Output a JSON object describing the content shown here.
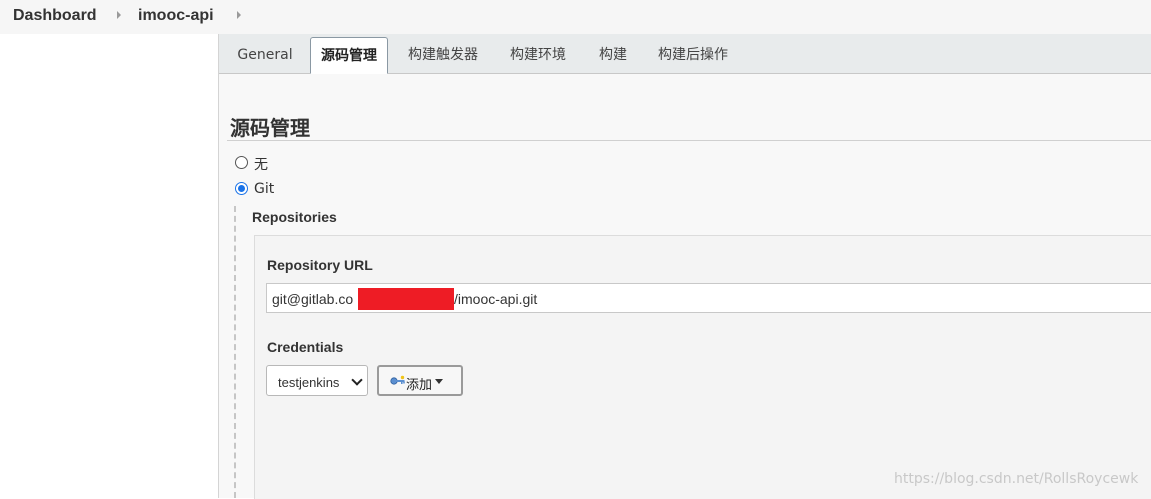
{
  "breadcrumb": {
    "items": [
      "Dashboard",
      "imooc-api"
    ]
  },
  "tabs": [
    {
      "label": "General",
      "active": false
    },
    {
      "label": "源码管理",
      "active": true
    },
    {
      "label": "构建触发器",
      "active": false
    },
    {
      "label": "构建环境",
      "active": false
    },
    {
      "label": "构建",
      "active": false
    },
    {
      "label": "构建后操作",
      "active": false
    }
  ],
  "scm": {
    "title": "源码管理",
    "options": [
      {
        "label": "无",
        "selected": false
      },
      {
        "label": "Git",
        "selected": true
      }
    ],
    "repositories_label": "Repositories",
    "repo_url_label": "Repository URL",
    "repo_url_prefix": "git@gitlab.co",
    "repo_url_suffix": "/imooc-api.git",
    "credentials_label": "Credentials",
    "credentials_selected": "testjenkins",
    "add_button_label": "添加"
  },
  "watermark": "https://blog.csdn.net/RollsRoycewk",
  "colors": {
    "accent": "#1a73e8",
    "redaction": "#ee1c25"
  }
}
